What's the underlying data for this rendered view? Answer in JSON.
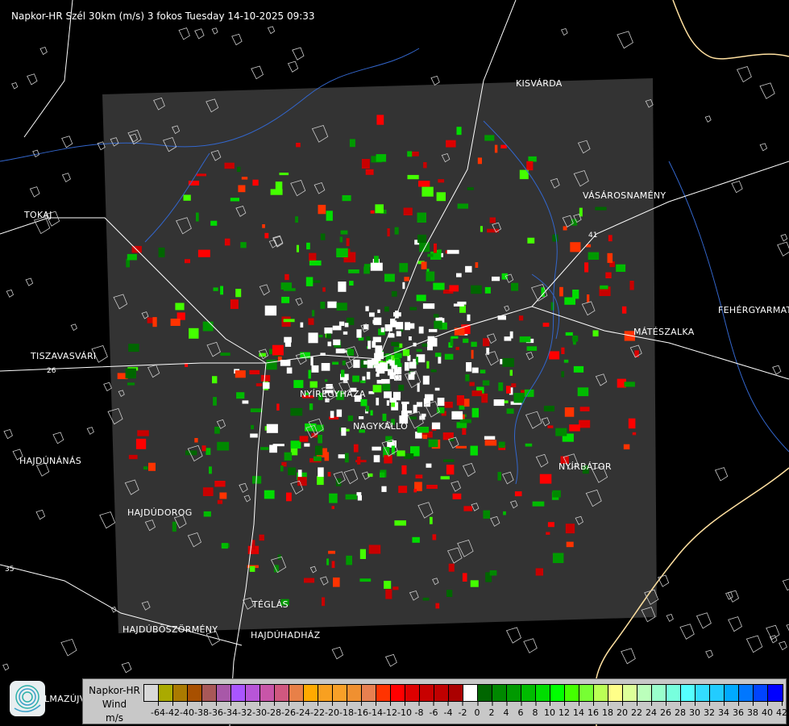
{
  "title": "Napkor-HR Szél 30km (m/s) 3 fokos Tuesday 14-10-2025 09:33",
  "cities": [
    {
      "name": "KISVÁRDA"
    },
    {
      "name": "VÁSÁROSNAMÉNY"
    },
    {
      "name": "TOKAJ"
    },
    {
      "name": "FEHÉRGYARMAT"
    },
    {
      "name": "MÁTÉSZALKA"
    },
    {
      "name": "TISZAVASVÁRI"
    },
    {
      "name": "NYÍREGYHÁZA"
    },
    {
      "name": "NAGYKÁLLÓ"
    },
    {
      "name": "HAJDÚNÁNÁS"
    },
    {
      "name": "NYÍRBÁTOR"
    },
    {
      "name": "HAJDÚDOROG"
    },
    {
      "name": "TÉGLÁS"
    },
    {
      "name": "HAJDÚBÖSZÖRMÉNY"
    },
    {
      "name": "HAJDÚHADHÁZ"
    },
    {
      "name": "LMAZÚJVÁROS"
    }
  ],
  "road_numbers": [
    "26",
    "35",
    "41"
  ],
  "legend": {
    "line1": "Napkor-HR",
    "line2": "Wind",
    "unit": "m/s",
    "labels": [
      "-64",
      "-42",
      "-40",
      "-38",
      "-36",
      "-34",
      "-32",
      "-30",
      "-28",
      "-26",
      "-24",
      "-22",
      "-20",
      "-18",
      "-16",
      "-14",
      "-12",
      "-10",
      "-8",
      "-6",
      "-4",
      "-2",
      "0",
      "2",
      "4",
      "6",
      "8",
      "10",
      "12",
      "14",
      "16",
      "18",
      "20",
      "22",
      "24",
      "26",
      "28",
      "30",
      "32",
      "34",
      "36",
      "38",
      "40",
      "42"
    ],
    "colors": [
      "#d8d8d8",
      "#aaaa00",
      "#aa7a00",
      "#a85000",
      "#a85858",
      "#a858a8",
      "#aa55ff",
      "#b855d8",
      "#c855a8",
      "#d05880",
      "#e88048",
      "#ffaa00",
      "#f8a020",
      "#f8a028",
      "#f09030",
      "#e88050",
      "#ff3300",
      "#ff0000",
      "#dd0000",
      "#c80000",
      "#c00000",
      "#aa0000",
      "#ffffff",
      "#006600",
      "#008800",
      "#009900",
      "#00bb00",
      "#00dd00",
      "#00ff00",
      "#44ff00",
      "#77ff33",
      "#bbff55",
      "#ffff88",
      "#ddff99",
      "#bbffbb",
      "#99ffcc",
      "#77ffdd",
      "#55ffff",
      "#33ddff",
      "#22ccff",
      "#00aaff",
      "#0077ff",
      "#0044ff",
      "#0000ff"
    ]
  },
  "colors": {
    "background": "#000000",
    "coverage": "#333333",
    "roads": "#ffffff",
    "rivers": "#3366cc",
    "border": "#ffe0a0"
  }
}
